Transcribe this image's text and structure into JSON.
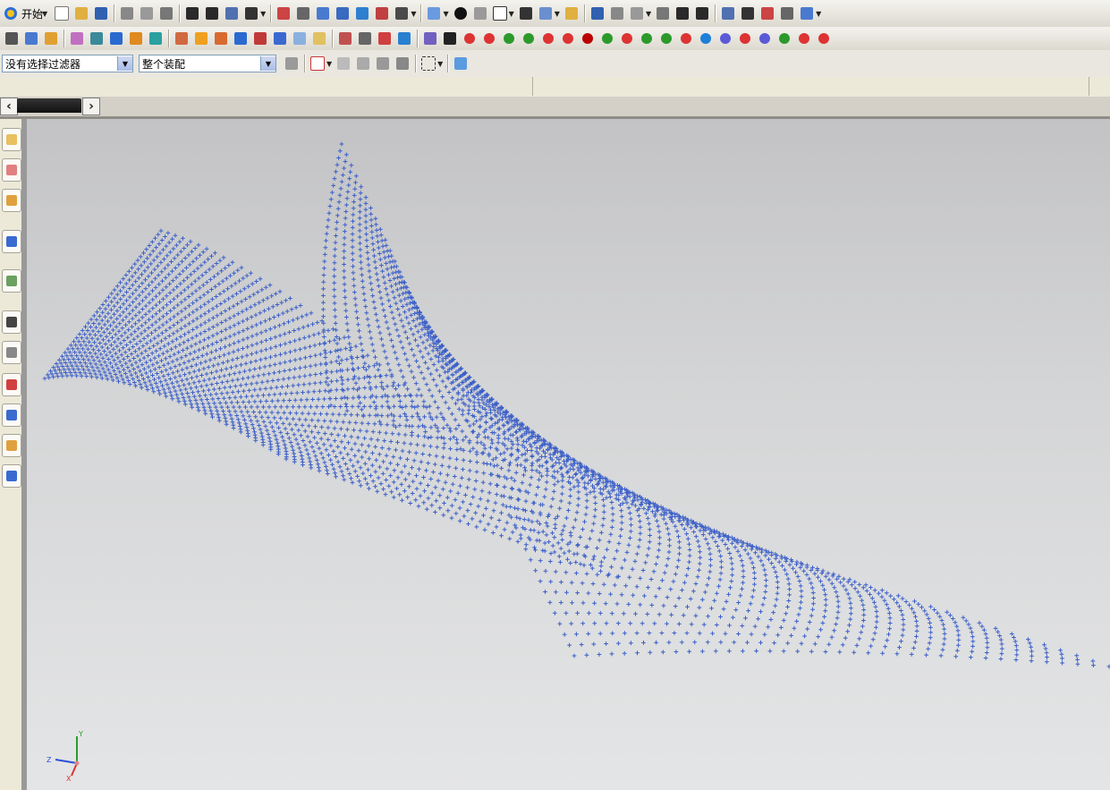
{
  "app": {
    "start_label": "开始"
  },
  "toolbar": {
    "filter_value": "没有选择过滤器",
    "scope_value": "整个装配"
  },
  "icons_row1": [
    "new-icon",
    "open-icon",
    "save-icon",
    "cut-icon",
    "copy-icon",
    "paste-icon",
    "undo-icon",
    "redo-icon",
    "select-icon",
    "view-icon",
    "fit-icon",
    "zoom-window-icon",
    "pan-icon",
    "zoom-icon",
    "rotate-icon",
    "snap-view-icon",
    "perspective-icon",
    "shaded-icon",
    "render-icon",
    "wireframe-icon",
    "background-icon",
    "layer-icon",
    "hidden-icon",
    "orient-icon",
    "move-icon",
    "sketch-icon",
    "curve-icon",
    "point-icon",
    "analysis-icon",
    "measure-icon",
    "cube1-icon",
    "cube2-icon",
    "cube3-icon",
    "cube4-icon",
    "delete-icon"
  ],
  "icons_row2_colors": [
    "#d33",
    "#d33",
    "#2b9a2b",
    "#2b9a2b",
    "#d33",
    "#d33",
    "#b00",
    "#2b9a2b",
    "#d33",
    "#2b9a2b",
    "#2b9a2b",
    "#d33",
    "#1e7fd8",
    "#5a5ad8",
    "#d33",
    "#5a5ad8",
    "#2b9a2b",
    "#d33",
    "#d33"
  ],
  "resource_icons": [
    "assembly-navigator-icon",
    "part-navigator-icon",
    "reuse-library-icon",
    "help-info-icon",
    "web-browser-icon",
    "history-icon",
    "system-materials-icon",
    "palette-icon",
    "roles-icon",
    "templates-icon",
    "display-icon"
  ],
  "colors": {
    "points": "#3b5fc8",
    "viewport_top": "#c3c3c5",
    "viewport_bottom": "#e4e5e6"
  },
  "triad": {
    "y": "Y",
    "z": "Z",
    "x": "X"
  }
}
